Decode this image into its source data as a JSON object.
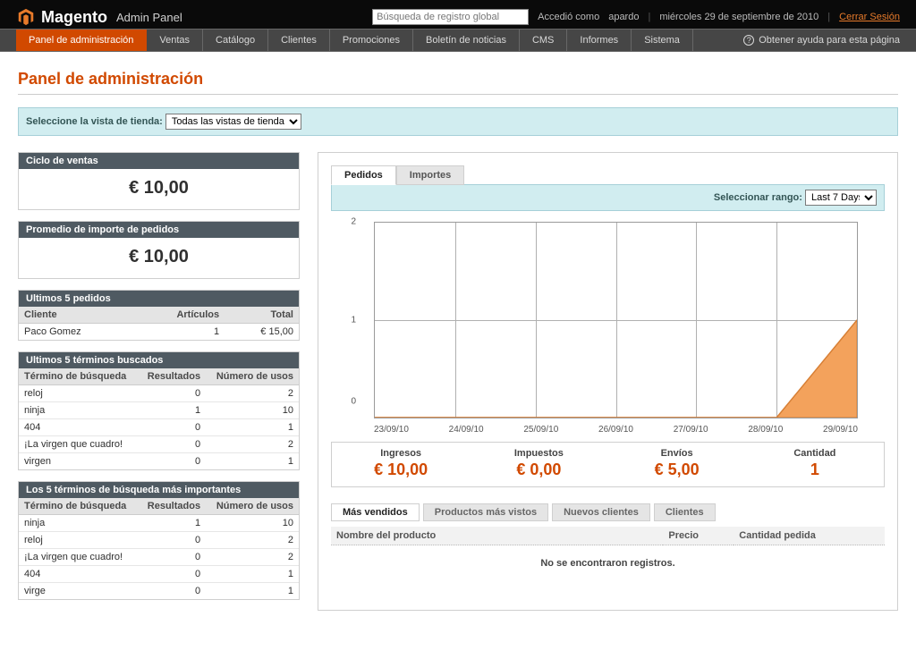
{
  "header": {
    "brand": "Magento",
    "panel_label": "Admin Panel",
    "search_placeholder": "Búsqueda de registro global",
    "logged_in_prefix": "Accedió como",
    "username": "apardo",
    "date": "miércoles 29 de septiembre de 2010",
    "logout": "Cerrar Sesión"
  },
  "nav": {
    "items": [
      "Panel de administración",
      "Ventas",
      "Catálogo",
      "Clientes",
      "Promociones",
      "Boletín de noticias",
      "CMS",
      "Informes",
      "Sistema"
    ],
    "help": "Obtener ayuda para esta página"
  },
  "page": {
    "title": "Panel de administración"
  },
  "store_bar": {
    "label": "Seleccione la vista de tienda:",
    "selected": "Todas las vistas de tienda"
  },
  "left": {
    "sales_cycle": {
      "title": "Ciclo de ventas",
      "value": "€ 10,00"
    },
    "avg_order": {
      "title": "Promedio de importe de pedidos",
      "value": "€ 10,00"
    },
    "last_orders": {
      "title": "Ultimos 5 pedidos",
      "cols": [
        "Cliente",
        "Artículos",
        "Total"
      ],
      "rows": [
        {
          "c0": "Paco Gomez",
          "c1": "1",
          "c2": "€ 15,00"
        }
      ]
    },
    "last_searches": {
      "title": "Ultimos 5 términos buscados",
      "cols": [
        "Término de búsqueda",
        "Resultados",
        "Número de usos"
      ],
      "rows": [
        {
          "c0": "reloj",
          "c1": "0",
          "c2": "2"
        },
        {
          "c0": "ninja",
          "c1": "1",
          "c2": "10"
        },
        {
          "c0": "404",
          "c1": "0",
          "c2": "1"
        },
        {
          "c0": "¡La virgen que cuadro!",
          "c1": "0",
          "c2": "2"
        },
        {
          "c0": "virgen",
          "c1": "0",
          "c2": "1"
        }
      ]
    },
    "top_searches": {
      "title": "Los 5 términos de búsqueda más importantes",
      "cols": [
        "Término de búsqueda",
        "Resultados",
        "Número de usos"
      ],
      "rows": [
        {
          "c0": "ninja",
          "c1": "1",
          "c2": "10"
        },
        {
          "c0": "reloj",
          "c1": "0",
          "c2": "2"
        },
        {
          "c0": "¡La virgen que cuadro!",
          "c1": "0",
          "c2": "2"
        },
        {
          "c0": "404",
          "c1": "0",
          "c2": "1"
        },
        {
          "c0": "virge",
          "c1": "0",
          "c2": "1"
        }
      ]
    }
  },
  "right": {
    "tabs": [
      "Pedidos",
      "Importes"
    ],
    "range_label": "Seleccionar rango:",
    "range_selected": "Last 7 Days",
    "stats": [
      {
        "label": "Ingresos",
        "value": "€ 10,00"
      },
      {
        "label": "Impuestos",
        "value": "€ 0,00"
      },
      {
        "label": "Envíos",
        "value": "€ 5,00"
      },
      {
        "label": "Cantidad",
        "value": "1"
      }
    ],
    "bottom_tabs": [
      "Más vendidos",
      "Productos más vistos",
      "Nuevos clientes",
      "Clientes"
    ],
    "grid_cols": [
      "Nombre del producto",
      "Precio",
      "Cantidad pedida"
    ],
    "no_records": "No se encontraron registros."
  },
  "chart_data": {
    "type": "line",
    "title": "",
    "xlabel": "",
    "ylabel": "",
    "ylim": [
      0,
      2
    ],
    "y_ticks": [
      0,
      1,
      2
    ],
    "categories": [
      "23/09/10",
      "24/09/10",
      "25/09/10",
      "26/09/10",
      "27/09/10",
      "28/09/10",
      "29/09/10"
    ],
    "series": [
      {
        "name": "Pedidos",
        "values": [
          0,
          0,
          0,
          0,
          0,
          0,
          1
        ]
      }
    ]
  }
}
